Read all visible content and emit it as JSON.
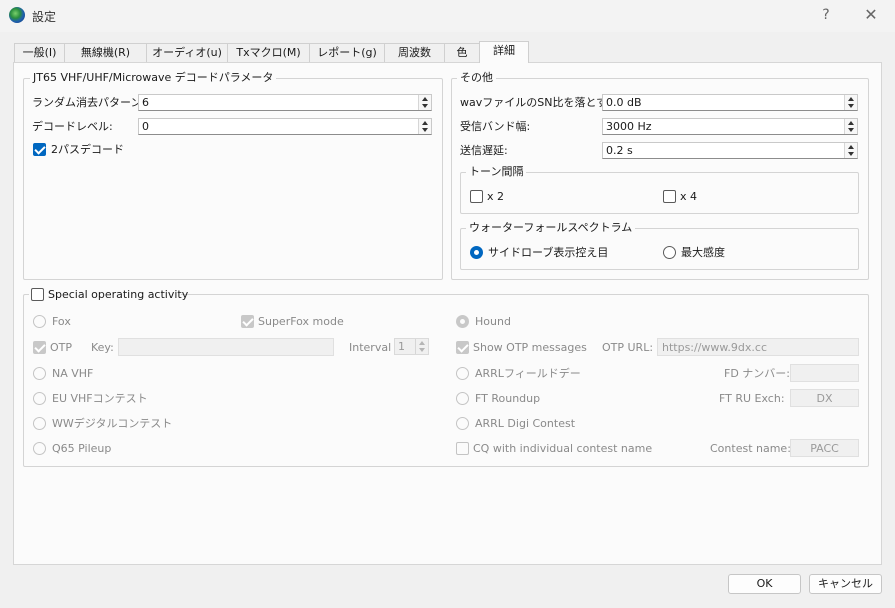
{
  "window": {
    "title": "設定",
    "help": "?",
    "close": "✕"
  },
  "tabs": [
    {
      "label": "一般(I)"
    },
    {
      "label": "無線機(R)"
    },
    {
      "label": "オーディオ(u)"
    },
    {
      "label": "Txマクロ(M)"
    },
    {
      "label": "レポート(g)"
    },
    {
      "label": "周波数"
    },
    {
      "label": "色"
    },
    {
      "label": "詳細"
    }
  ],
  "active_tab": "詳細",
  "decode_group": {
    "title": "JT65 VHF/UHF/Microwave デコードパラメータ",
    "random_erasure_label": "ランダム消去パターン:",
    "random_erasure_value": "6",
    "decode_level_label": "デコードレベル:",
    "decode_level_value": "0",
    "two_pass_label": "2パスデコード",
    "two_pass_checked": true
  },
  "misc_group": {
    "title": "その他",
    "wav_snr_label": "wavファイルのSN比を落とす:",
    "wav_snr_value": "0.0 dB",
    "rx_bandwidth_label": "受信バンド幅:",
    "rx_bandwidth_value": "3000  Hz",
    "tx_delay_label": "送信遅延:",
    "tx_delay_value": "0.2  s"
  },
  "tone_group": {
    "title": "トーン間隔",
    "x2_label": "x 2",
    "x4_label": "x 4"
  },
  "waterfall_group": {
    "title": "ウォーターフォールスペクトラム",
    "sidelobe_label": "サイドローブ表示控え目",
    "max_sensitivity_label": "最大感度",
    "selected": "サイドローブ表示控え目"
  },
  "special": {
    "title": "Special operating activity",
    "fox": "Fox",
    "superfox": "SuperFox mode",
    "hound": "Hound",
    "otp": "OTP",
    "key_label": "Key:",
    "key_value": "",
    "interval_label": "Interval",
    "interval_value": "1",
    "show_otp": "Show OTP messages",
    "otp_url_label": "OTP URL:",
    "otp_url_value": "https://www.9dx.cc",
    "na_vhf": "NA VHF",
    "arrl_field_day": "ARRLフィールドデー",
    "fd_number_label": "FD ナンバー:",
    "fd_number_value": "",
    "eu_vhf": "EU VHFコンテスト",
    "ft_roundup": "FT Roundup",
    "ft_ru_exch_label": "FT RU Exch:",
    "ft_ru_exch_value": "DX",
    "ww_digi": "WWデジタルコンテスト",
    "arrl_digi": "ARRL Digi Contest",
    "q65_pileup": "Q65 Pileup",
    "cq_individual": "CQ with individual contest name",
    "contest_name_label": "Contest name:",
    "contest_name_value": "PACC"
  },
  "footer": {
    "ok": "OK",
    "cancel": "キャンセル"
  },
  "colors": {
    "accent": "#0067c0",
    "panel": "#fbfbfb",
    "window": "#f0f0f0"
  }
}
